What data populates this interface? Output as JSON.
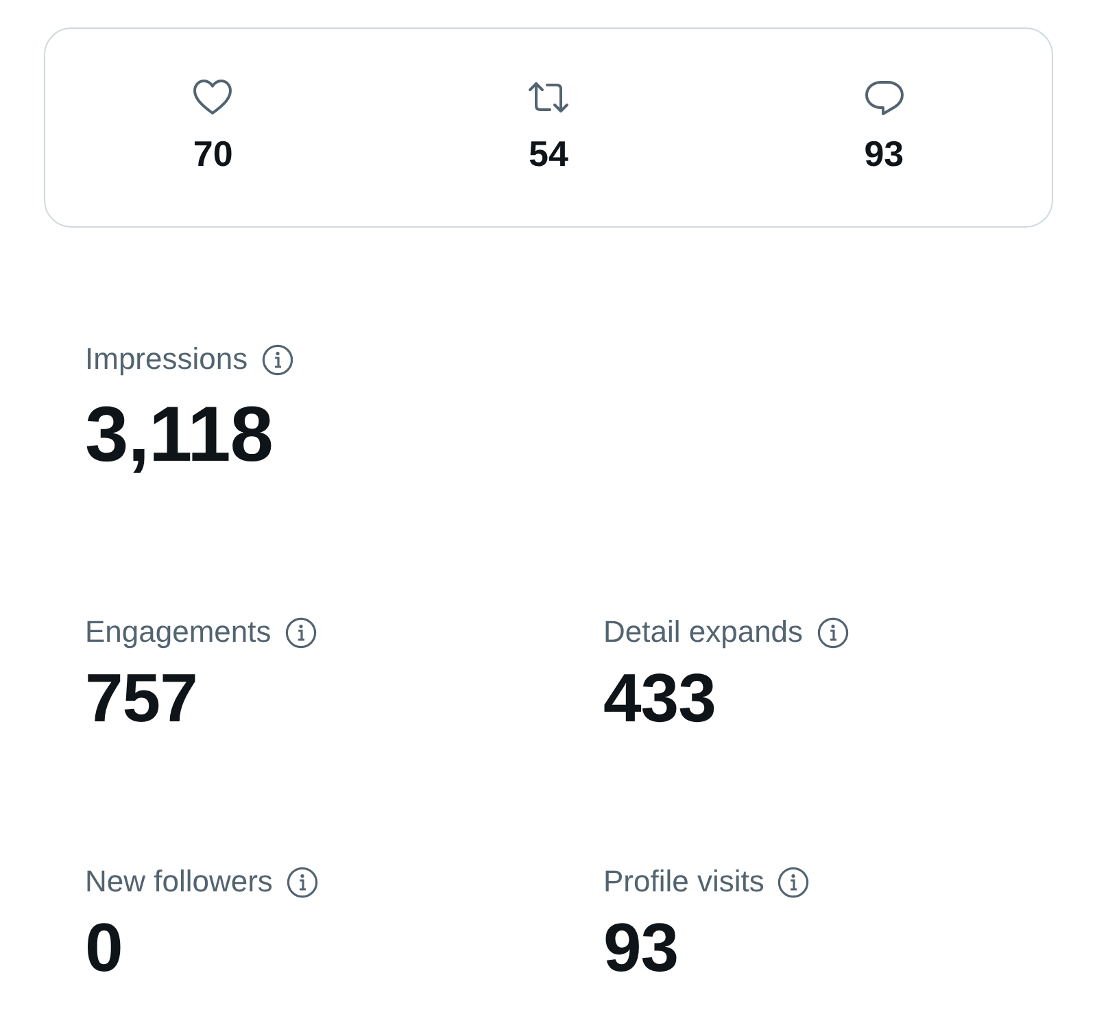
{
  "engagement_card": [
    {
      "kind": "like",
      "count": "70"
    },
    {
      "kind": "repost",
      "count": "54"
    },
    {
      "kind": "reply",
      "count": "93"
    }
  ],
  "highlight": {
    "label": "Impressions",
    "value": "3,118"
  },
  "metrics": [
    {
      "label": "Engagements",
      "value": "757"
    },
    {
      "label": "Detail expands",
      "value": "433"
    },
    {
      "label": "New followers",
      "value": "0"
    },
    {
      "label": "Profile visits",
      "value": "93"
    }
  ]
}
